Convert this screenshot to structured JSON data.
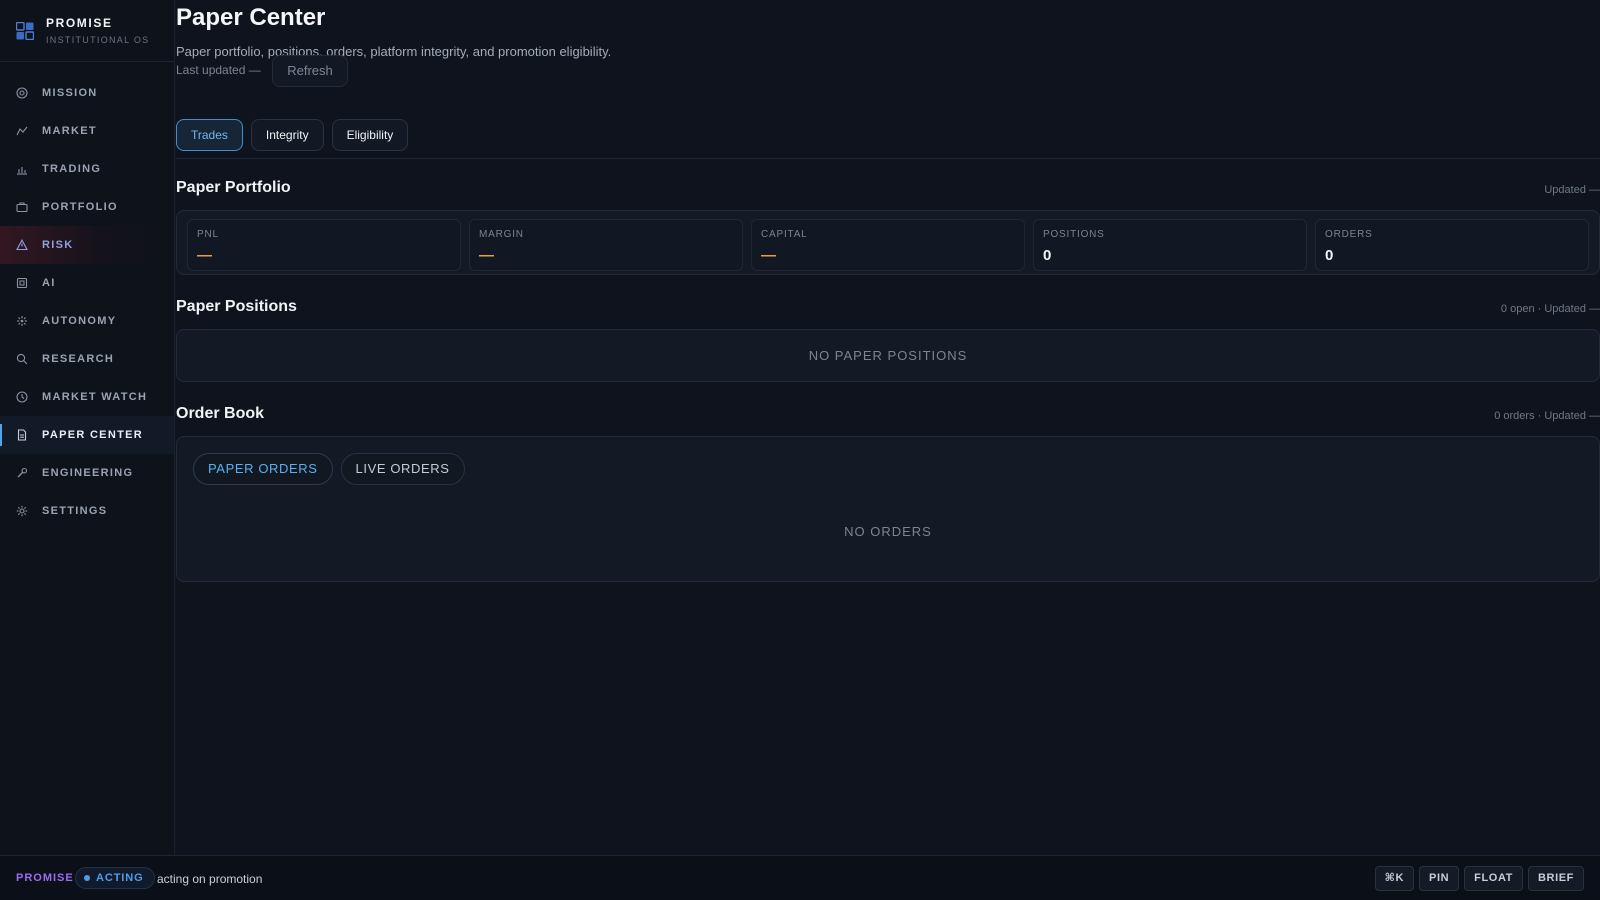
{
  "brand": {
    "name": "PROMISE",
    "subtitle": "INSTITUTIONAL OS"
  },
  "sidebar": {
    "items": [
      {
        "label": "MISSION",
        "icon": "target-icon"
      },
      {
        "label": "MARKET",
        "icon": "chart-line-icon"
      },
      {
        "label": "TRADING",
        "icon": "bar-chart-icon"
      },
      {
        "label": "PORTFOLIO",
        "icon": "briefcase-icon"
      },
      {
        "label": "RISK",
        "icon": "warning-icon"
      },
      {
        "label": "AI",
        "icon": "cpu-icon"
      },
      {
        "label": "AUTONOMY",
        "icon": "atom-icon"
      },
      {
        "label": "RESEARCH",
        "icon": "search-icon"
      },
      {
        "label": "MARKET WATCH",
        "icon": "clock-icon"
      },
      {
        "label": "PAPER CENTER",
        "icon": "document-icon"
      },
      {
        "label": "ENGINEERING",
        "icon": "wrench-icon"
      },
      {
        "label": "SETTINGS",
        "icon": "gear-icon"
      }
    ],
    "active": "PAPER CENTER"
  },
  "header": {
    "title": "Paper Center",
    "subtitle": "Paper portfolio, positions, orders, platform integrity, and promotion eligibility.",
    "last_updated": "Last updated —",
    "refresh_label": "Refresh"
  },
  "tabs": [
    {
      "label": "Trades",
      "active": true
    },
    {
      "label": "Integrity",
      "active": false
    },
    {
      "label": "Eligibility",
      "active": false
    }
  ],
  "portfolio": {
    "title": "Paper Portfolio",
    "meta": "Updated —",
    "kpis": [
      {
        "label": "PNL",
        "value": "—"
      },
      {
        "label": "MARGIN",
        "value": "—"
      },
      {
        "label": "CAPITAL",
        "value": "—"
      },
      {
        "label": "POSITIONS",
        "value": "0"
      },
      {
        "label": "ORDERS",
        "value": "0"
      }
    ]
  },
  "positions": {
    "title": "Paper Positions",
    "meta": "0 open · Updated —",
    "empty": "NO PAPER POSITIONS"
  },
  "order_book": {
    "title": "Order Book",
    "meta": "0 orders · Updated —",
    "tabs": [
      {
        "label": "PAPER ORDERS",
        "active": true
      },
      {
        "label": "LIVE ORDERS",
        "active": false
      }
    ],
    "empty": "NO ORDERS"
  },
  "statusbar": {
    "brand": "PROMISE",
    "state": "ACTING",
    "message": "acting on promotion",
    "actions": [
      "⌘K",
      "PIN",
      "FLOAT",
      "BRIEF"
    ]
  },
  "colors": {
    "accent": "#4ea4e8",
    "warning_value": "#f0a13a",
    "brand_status": "#9b6cf2"
  }
}
